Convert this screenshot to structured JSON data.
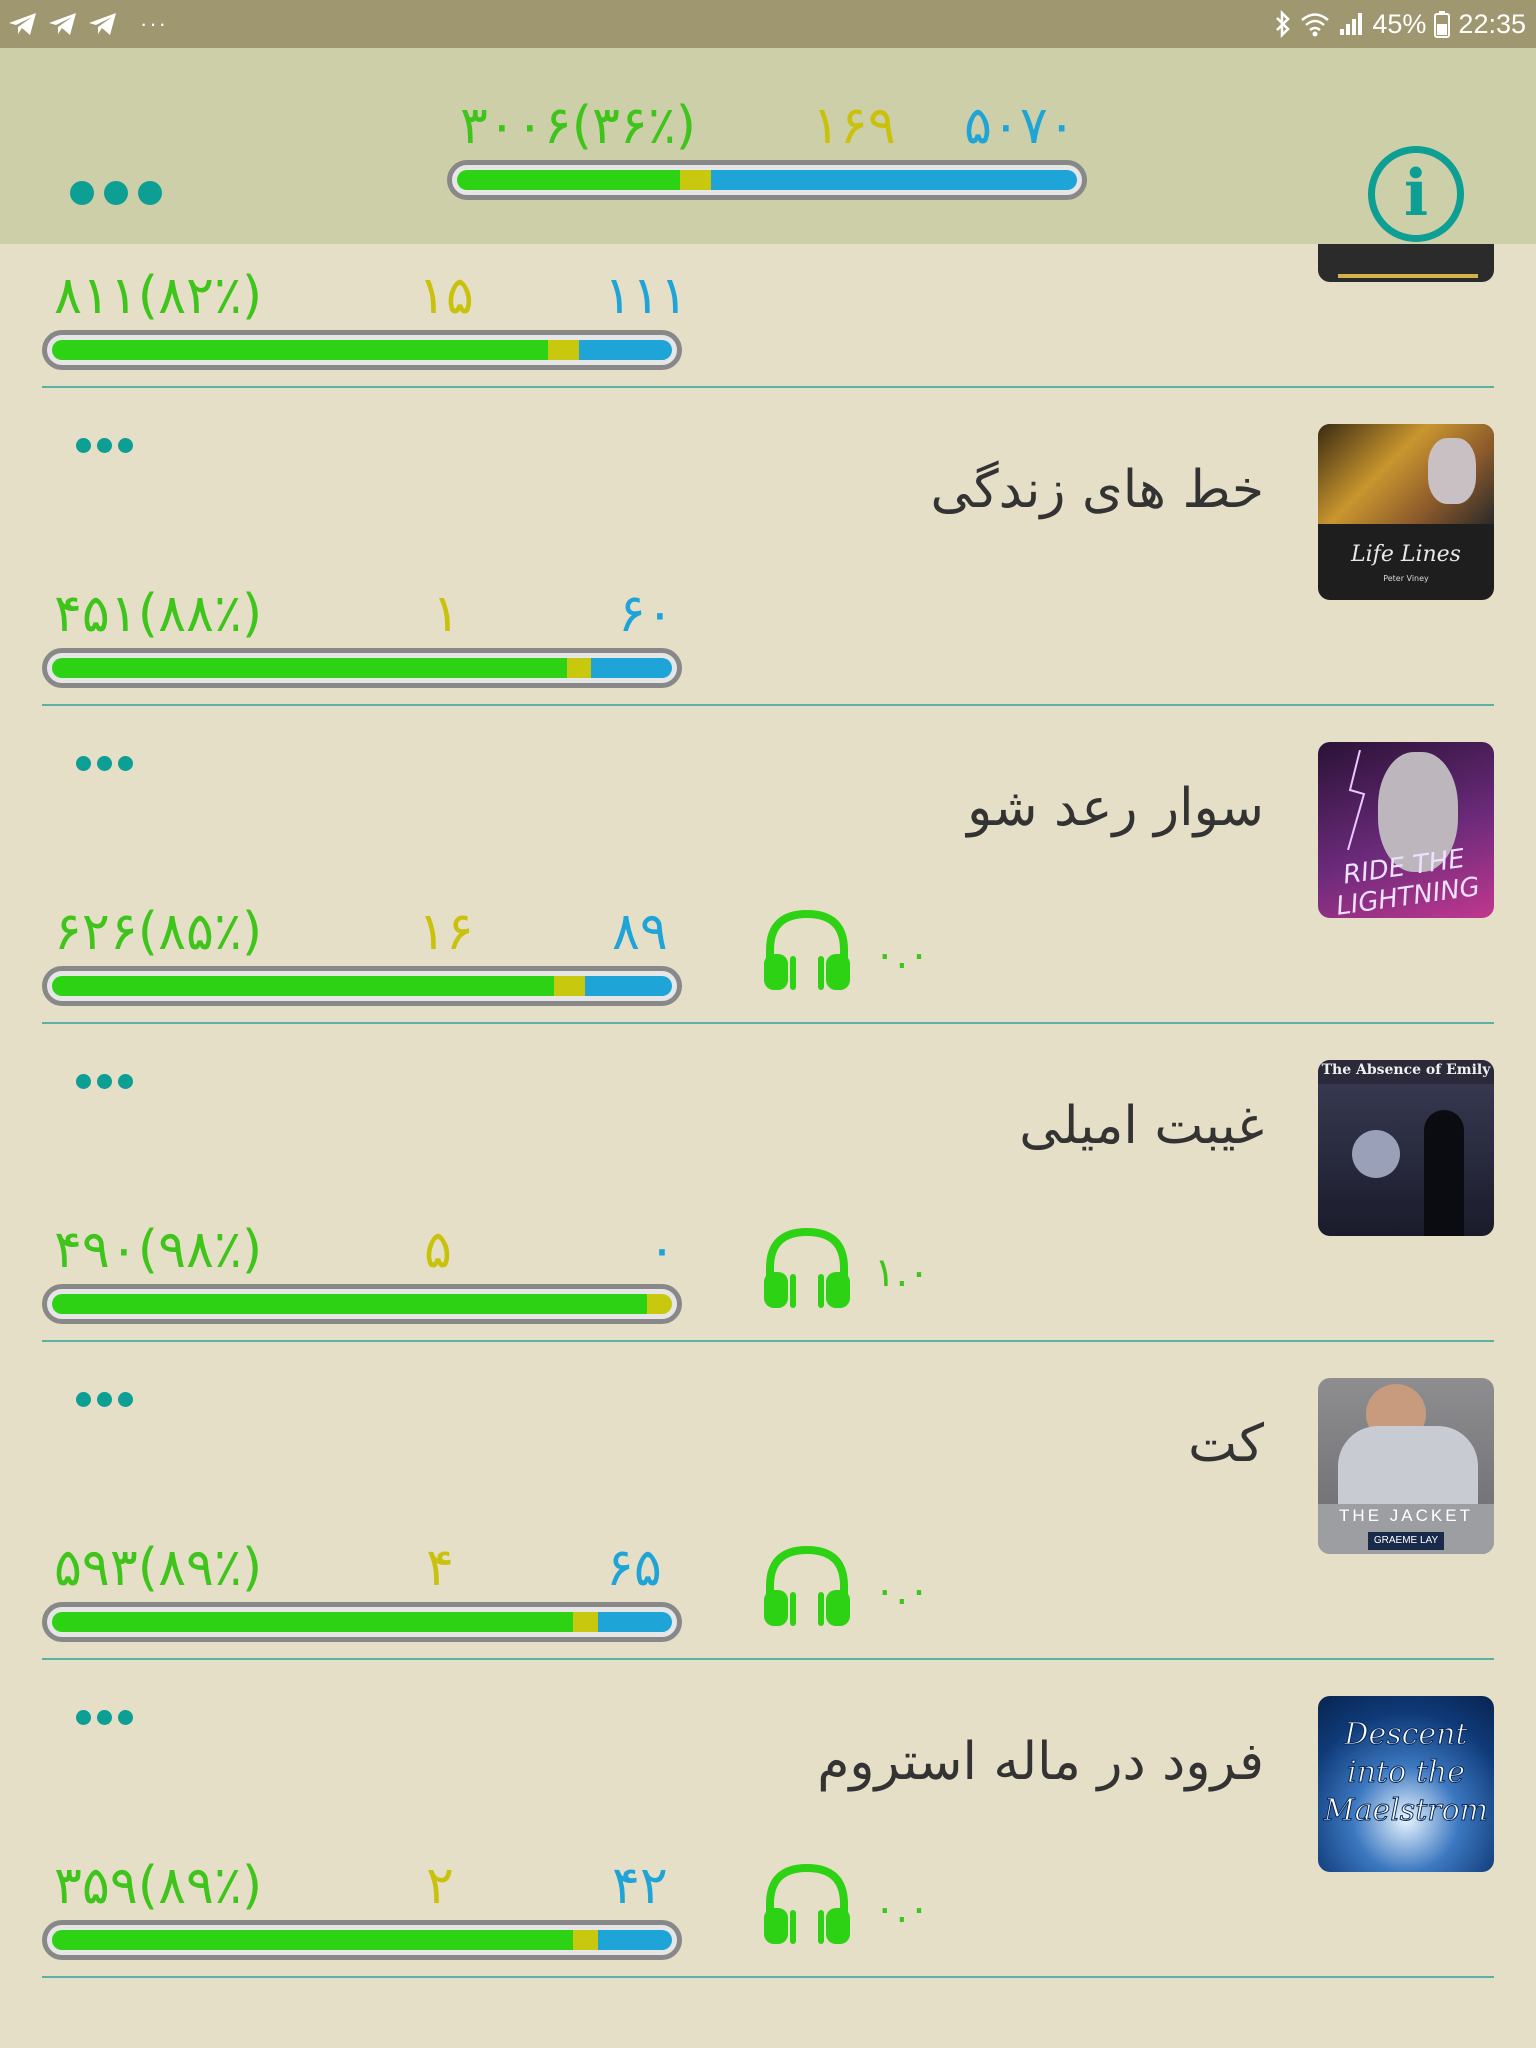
{
  "status_bar": {
    "battery": "45%",
    "time": "22:35",
    "notification_icons": [
      "telegram-icon",
      "telegram-icon",
      "telegram-icon"
    ],
    "more": "···"
  },
  "header": {
    "total_known": "۳۰۰۶(۳۶٪)",
    "total_learning": "۱۶۹",
    "total_new": "۵۰۷۰",
    "progress": {
      "green": 0.36,
      "yellow": 0.05,
      "blue": 0.59
    }
  },
  "books": [
    {
      "title": "",
      "known": "۸۱۱(۸۲٪)",
      "learning": "۱۵",
      "new": "۱۱۱",
      "progress": {
        "green": 0.8,
        "yellow": 0.05,
        "blue": 0.15
      },
      "has_audio": false,
      "rating": ""
    },
    {
      "title": "خط های زندگی",
      "cover_text": "Life Lines",
      "cover_author": "Peter Viney",
      "known": "۴۵۱(۸۸٪)",
      "learning": "۱",
      "new": "۶۰",
      "progress": {
        "green": 0.83,
        "yellow": 0.04,
        "blue": 0.13
      },
      "has_audio": false,
      "rating": ""
    },
    {
      "title": "سوار رعد شو",
      "cover_text": "RIDE THE LIGHTNING",
      "known": "۶۲۶(۸۵٪)",
      "learning": "۱۶",
      "new": "۸۹",
      "progress": {
        "green": 0.81,
        "yellow": 0.05,
        "blue": 0.14
      },
      "has_audio": true,
      "rating": "۰.۰"
    },
    {
      "title": "غیبت امیلی",
      "cover_text": "The Absence of Emily",
      "known": "۴۹۰(۹۸٪)",
      "learning": "۵",
      "new": "۰",
      "progress": {
        "green": 0.96,
        "yellow": 0.04,
        "blue": 0.0
      },
      "has_audio": true,
      "rating": "۱.۰"
    },
    {
      "title": "کت",
      "cover_text": "THE JACKET",
      "cover_author": "GRAEME LAY",
      "known": "۵۹۳(۸۹٪)",
      "learning": "۴",
      "new": "۶۵",
      "progress": {
        "green": 0.84,
        "yellow": 0.04,
        "blue": 0.12
      },
      "has_audio": true,
      "rating": "۰.۰"
    },
    {
      "title": "فرود در ماله استروم",
      "cover_text": "Descent into the Maelstrom",
      "known": "۳۵۹(۸۹٪)",
      "learning": "۲",
      "new": "۴۲",
      "progress": {
        "green": 0.84,
        "yellow": 0.04,
        "blue": 0.12
      },
      "has_audio": true,
      "rating": "۰.۰"
    }
  ],
  "colors": {
    "status_bar": "#9e976f",
    "header": "#cdcfa8",
    "background": "#e6dfc8",
    "accent": "#0d9e94",
    "known_green": "#3ec41a",
    "learning_yellow": "#c9c20d",
    "new_blue": "#1fa4d8"
  },
  "icons": {
    "menu": "more-horizontal-icon",
    "info": "info-icon",
    "audio": "headphones-icon",
    "item_menu": "more-horizontal-icon"
  }
}
